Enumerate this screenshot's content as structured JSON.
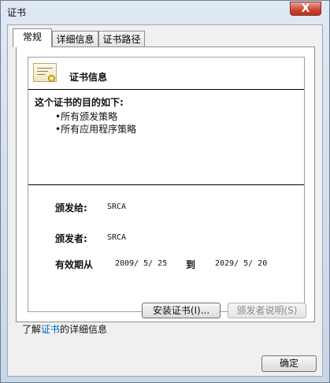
{
  "window": {
    "title": "证书",
    "close_glyph": "X"
  },
  "tabs": [
    {
      "label": "常规",
      "active": true
    },
    {
      "label": "详细信息",
      "active": false
    },
    {
      "label": "证书路径",
      "active": false
    }
  ],
  "certificate": {
    "info_title": "证书信息",
    "purpose_heading": "这个证书的目的如下:",
    "purposes": [
      "•所有颁发策略",
      "•所有应用程序策略"
    ],
    "issued_to_label": "颁发给:",
    "issued_to_value": "SRCA",
    "issued_by_label": "颁发者:",
    "issued_by_value": "SRCA",
    "validity_label": "有效期从",
    "valid_from": "2009/ 5/ 25",
    "to_label": "到",
    "valid_to": "2029/ 5/ 20"
  },
  "buttons": {
    "install": "安装证书(I)...",
    "issuer_statement": "颁发者说明(S)",
    "ok": "确定"
  },
  "learn_more": {
    "prefix": "了解",
    "link": "证书",
    "suffix": "的详细信息"
  },
  "icons": {
    "certificate": "certificate-icon",
    "seal": "seal-icon"
  }
}
